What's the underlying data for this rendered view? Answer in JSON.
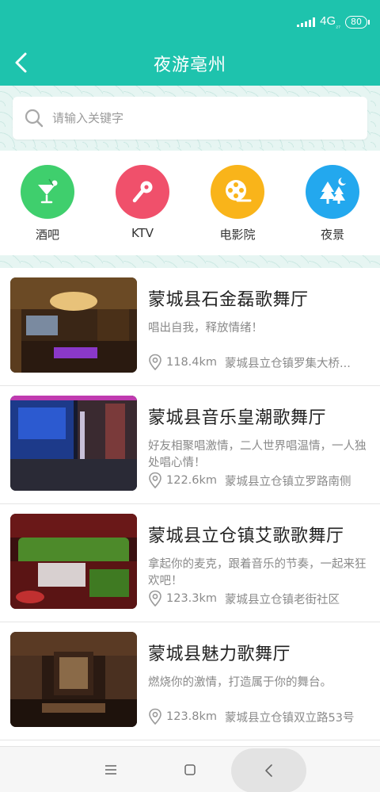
{
  "status_bar": {
    "network": "4G",
    "network_sub": "₂₇",
    "battery": "80"
  },
  "header": {
    "title": "夜游亳州"
  },
  "search": {
    "placeholder": "请输入关键字"
  },
  "categories": [
    {
      "label": "酒吧",
      "icon": "cocktail-icon",
      "color": "#3fcf6d"
    },
    {
      "label": "KTV",
      "icon": "microphone-icon",
      "color": "#f0506b"
    },
    {
      "label": "电影院",
      "icon": "film-reel-icon",
      "color": "#f9b41a"
    },
    {
      "label": "夜景",
      "icon": "night-trees-icon",
      "color": "#23a8ee"
    }
  ],
  "venues": [
    {
      "name": "蒙城县石金磊歌舞厅",
      "desc": "唱出自我，释放情绪！",
      "distance": "118.4km",
      "address": "蒙城县立仓镇罗集大桥..."
    },
    {
      "name": "蒙城县音乐皇潮歌舞厅",
      "desc": "好友相聚唱激情，二人世界唱温情，一人独处唱心情！",
      "distance": "122.6km",
      "address": "蒙城县立仓镇立罗路南侧"
    },
    {
      "name": "蒙城县立仓镇艾歌歌舞厅",
      "desc": "拿起你的麦克，跟着音乐的节奏，一起来狂欢吧！",
      "distance": "123.3km",
      "address": "蒙城县立仓镇老街社区"
    },
    {
      "name": "蒙城县魅力歌舞厅",
      "desc": "燃烧你的激情，打造属于你的舞台。",
      "distance": "123.8km",
      "address": "蒙城县立仓镇双立路53号"
    }
  ],
  "colors": {
    "primary": "#1ec3ad",
    "text": "#222222",
    "muted": "#8a8a8a"
  }
}
